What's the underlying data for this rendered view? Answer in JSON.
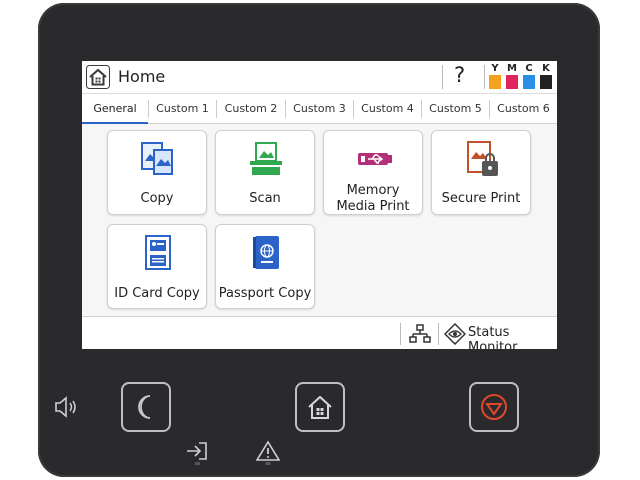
{
  "header": {
    "title": "Home",
    "help_label": "?",
    "inks": [
      {
        "label": "Y",
        "color": "#f4a11c"
      },
      {
        "label": "M",
        "color": "#e0245e"
      },
      {
        "label": "C",
        "color": "#2b8fe8"
      },
      {
        "label": "K",
        "color": "#222222"
      }
    ]
  },
  "tabs": [
    "General",
    "Custom 1",
    "Custom 2",
    "Custom 3",
    "Custom 4",
    "Custom 5",
    "Custom 6"
  ],
  "active_tab": "General",
  "apps": {
    "copy": "Copy",
    "scan": "Scan",
    "memory_line1": "Memory",
    "memory_line2": "Media Print",
    "secure_print": "Secure Print",
    "id_card_copy": "ID Card Copy",
    "passport_copy": "Passport Copy"
  },
  "footer": {
    "status_monitor": "Status Monitor",
    "network_icon": "network-icon",
    "status_icon": "eye-icon"
  },
  "hardware": {
    "volume_icon": "volume-icon",
    "sleep_icon": "moon-icon",
    "home_icon": "home-icon",
    "stop_icon": "stop-icon",
    "data_icon": "data-arrow-icon",
    "error_icon": "warning-icon"
  },
  "colors": {
    "accent": "#2b63c9",
    "stop": "#e2472e",
    "scan_green": "#2fa84f",
    "memory_magenta": "#b3307a",
    "secure_brown": "#c0522b"
  }
}
